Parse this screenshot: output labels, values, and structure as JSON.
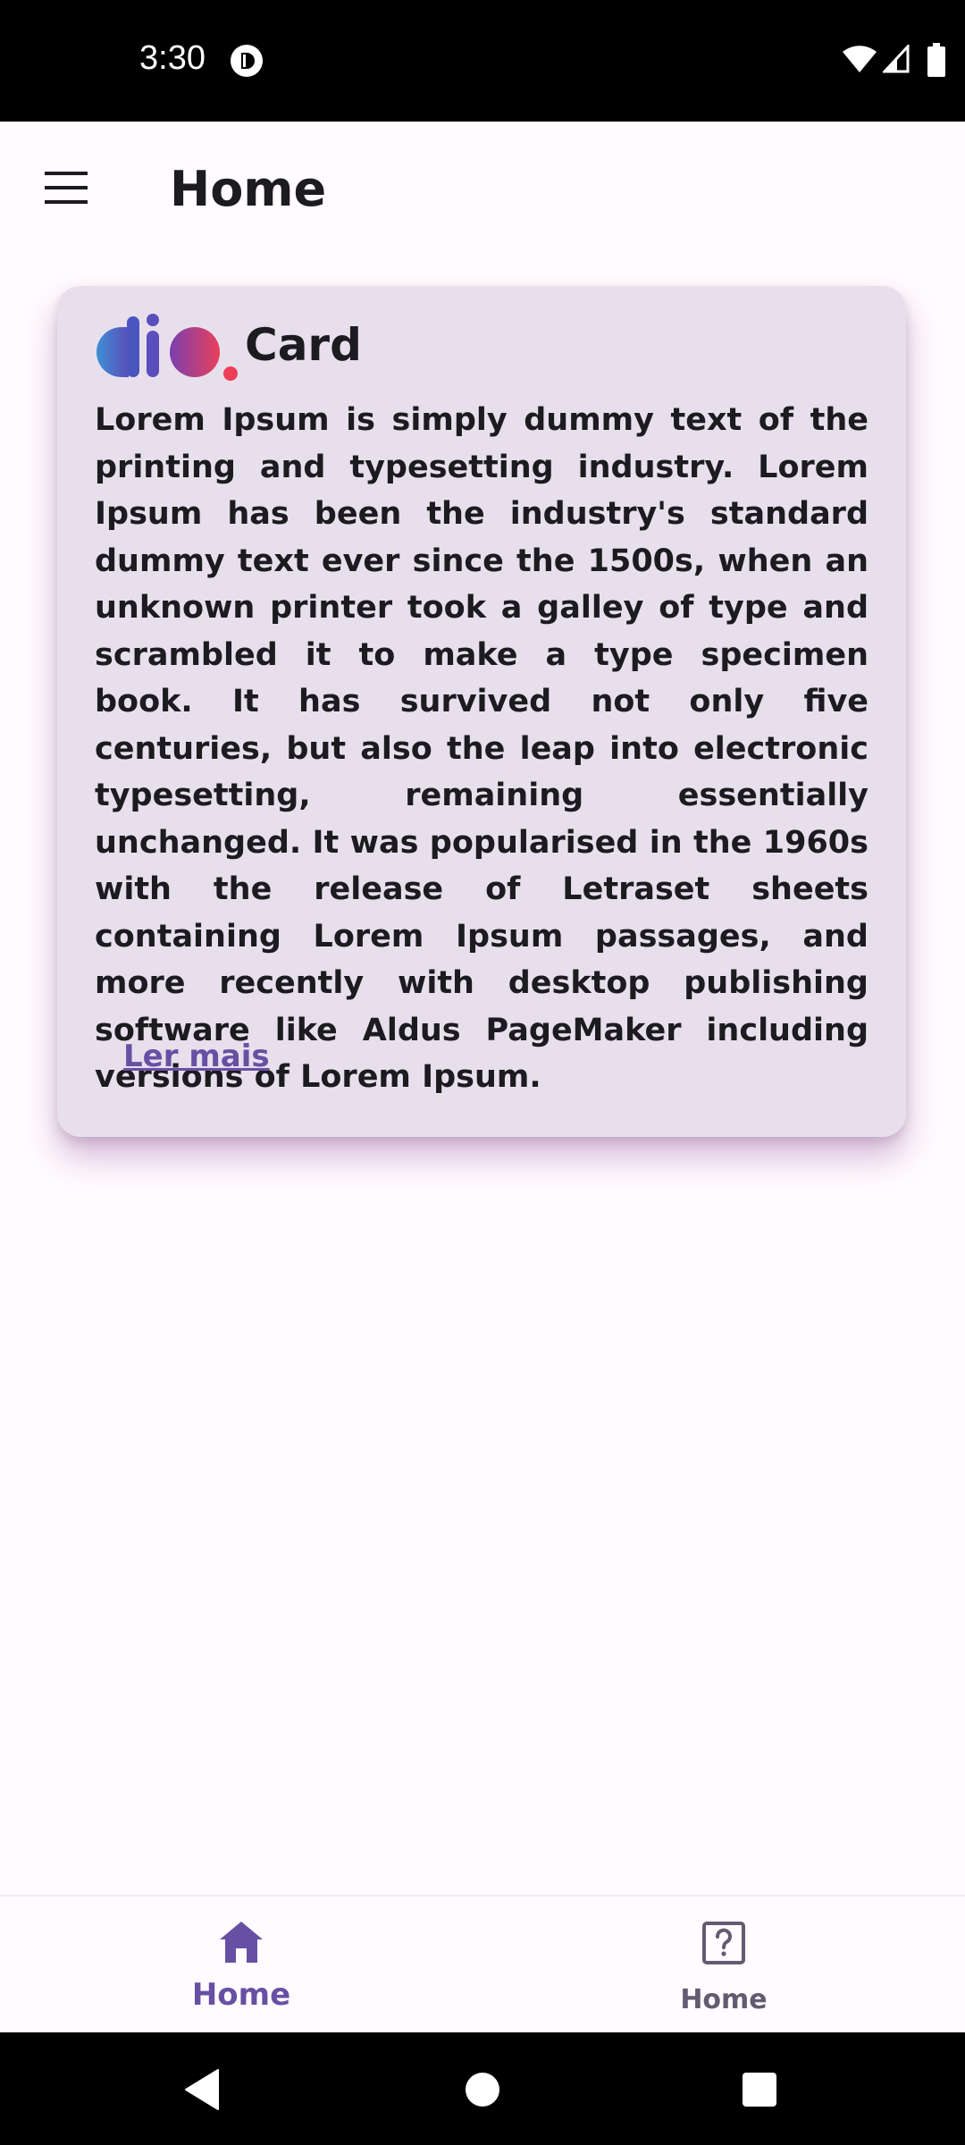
{
  "status_bar": {
    "time": "3:30",
    "icons": [
      "app-notification-icon",
      "wifi-icon",
      "cell-signal-icon",
      "battery-icon"
    ]
  },
  "app_bar": {
    "menu_icon": "hamburger-menu-icon",
    "title": "Home"
  },
  "card": {
    "logo_icon": "dio-logo-icon",
    "title": "Card",
    "body": "Lorem Ipsum is simply dummy text of the printing and typesetting industry. Lorem Ipsum has been the industry's standard dummy text ever since the 1500s, when an unknown printer took a galley of type and scrambled it to make a type specimen book. It has survived not only five centuries, but also the leap into electronic typesetting, remaining essentially unchanged. It was popularised in the 1960s with the release of Letraset sheets containing Lorem Ipsum passages, and more recently with desktop publishing software like Aldus PageMaker including versions of Lorem Ipsum.",
    "link_label": "Ler mais"
  },
  "bottom_nav": {
    "items": [
      {
        "label": "Home",
        "icon": "home-icon",
        "selected": true
      },
      {
        "label": "Home",
        "icon": "help-icon",
        "selected": false
      }
    ]
  },
  "system_nav": {
    "icons": [
      "back-icon",
      "home-circle-icon",
      "recents-icon"
    ]
  },
  "colors": {
    "primary": "#6750a4",
    "card_background": "#e7e0ec",
    "page_background": "#fffbfe",
    "secondary_text": "#625b71"
  }
}
